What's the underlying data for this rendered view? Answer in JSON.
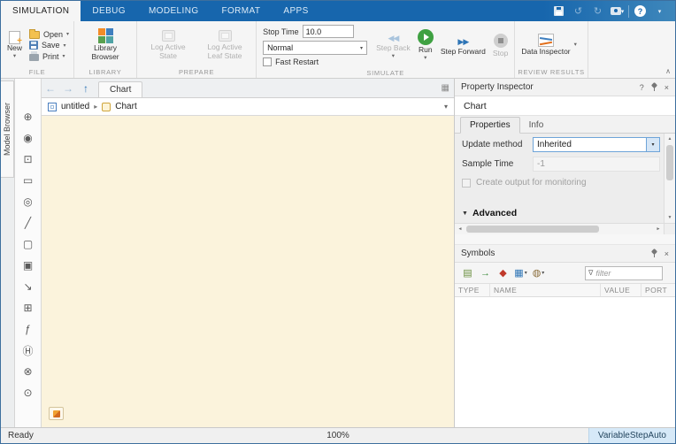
{
  "tabbar": {
    "tabs": [
      {
        "label": "SIMULATION"
      },
      {
        "label": "DEBUG"
      },
      {
        "label": "MODELING"
      },
      {
        "label": "FORMAT"
      },
      {
        "label": "APPS"
      }
    ]
  },
  "icons": {
    "caret_down": "▾",
    "collapse": "∧",
    "undo": "↺",
    "redo": "↻",
    "help": "?",
    "close": "×",
    "back_arrow": "←",
    "forward_arrow": "→",
    "up_arrow": "↑",
    "breadcrumb_sep": "▸",
    "scroll_up": "▲",
    "scroll_down": "▼",
    "scroll_left": "◄",
    "scroll_right": "►",
    "advanced_caret": "▼",
    "funnel": "∇",
    "step_back": "◀◀",
    "step_forward": "▶▶",
    "grid": "▦",
    "sym_grid": "▤",
    "sym_arrow": "→",
    "sym_diamond": "◆",
    "sym_view": "▦",
    "sym_misc": "◍"
  },
  "toolstrip": {
    "file": {
      "section_label": "FILE",
      "new_label": "New",
      "open_label": "Open",
      "save_label": "Save",
      "print_label": "Print"
    },
    "library": {
      "section_label": "LIBRARY",
      "browser_label": "Library Browser"
    },
    "prepare": {
      "section_label": "PREPARE",
      "log_active_state_label": "Log Active State",
      "log_active_leaf_state_label": "Log Active Leaf State"
    },
    "simulate": {
      "section_label": "SIMULATE",
      "stop_time_label": "Stop Time",
      "stop_time_value": "10.0",
      "mode_value": "Normal",
      "fast_restart_label": "Fast Restart",
      "step_back_label": "Step Back",
      "run_label": "Run",
      "step_forward_label": "Step Forward",
      "stop_label": "Stop"
    },
    "review": {
      "section_label": "REVIEW RESULTS",
      "data_inspector_label": "Data Inspector"
    }
  },
  "model_browser": {
    "label": "Model Browser"
  },
  "palette": {
    "items": [
      {
        "name": "explore-tool-icon",
        "glyph": "⊕"
      },
      {
        "name": "zoom-in-icon",
        "glyph": "◉"
      },
      {
        "name": "fit-to-view-icon",
        "glyph": "⊡"
      },
      {
        "name": "annotation-icon",
        "glyph": "▭"
      },
      {
        "name": "spotlight-icon",
        "glyph": "◎"
      },
      {
        "name": "pencil-icon",
        "glyph": "╱"
      },
      {
        "name": "state-icon",
        "glyph": "▢"
      },
      {
        "name": "box-icon",
        "glyph": "▣"
      },
      {
        "name": "transition-icon",
        "glyph": "↘"
      },
      {
        "name": "truth-table-icon",
        "glyph": "⊞"
      },
      {
        "name": "matlab-function-icon",
        "glyph": "ƒ"
      },
      {
        "name": "history-junction-icon",
        "glyph": "Ⓗ"
      },
      {
        "name": "exclusion-icon",
        "glyph": "⊗"
      },
      {
        "name": "junction-icon",
        "glyph": "⊙"
      }
    ]
  },
  "canvas": {
    "tab_label": "Chart",
    "breadcrumb_root": "untitled",
    "breadcrumb_current": "Chart"
  },
  "inspector": {
    "title": "Property Inspector",
    "object_name": "Chart",
    "tabs": [
      {
        "label": "Properties"
      },
      {
        "label": "Info"
      }
    ],
    "update_method_label": "Update method",
    "update_method_value": "Inherited",
    "sample_time_label": "Sample Time",
    "sample_time_value": "-1",
    "monitoring_label": "Create output for monitoring",
    "advanced_label": "Advanced"
  },
  "symbols": {
    "title": "Symbols",
    "filter_placeholder": "filter",
    "columns": [
      {
        "label": "TYPE"
      },
      {
        "label": "NAME"
      },
      {
        "label": "VALUE"
      },
      {
        "label": "PORT"
      }
    ]
  },
  "statusbar": {
    "state": "Ready",
    "zoom": "100%",
    "solver": "VariableStepAuto"
  }
}
